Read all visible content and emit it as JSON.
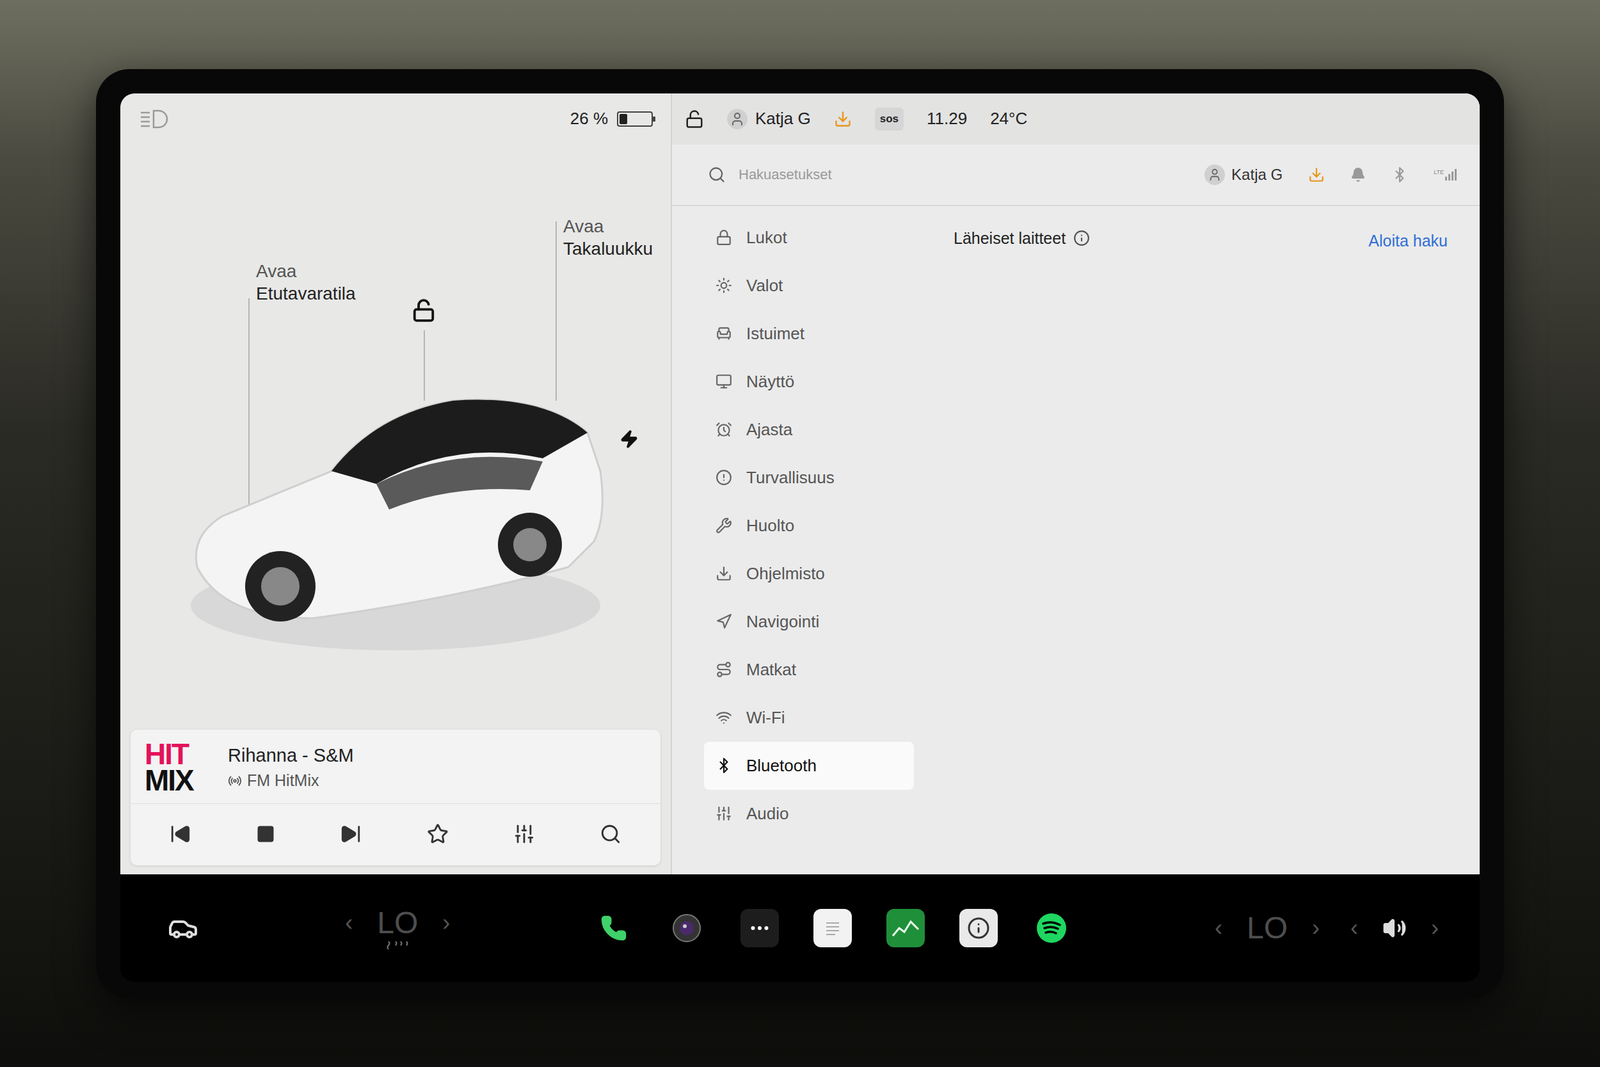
{
  "status_bar": {
    "battery_percent": "26 %",
    "battery_level": 0.26,
    "locked": false,
    "user": "Katja G",
    "sos": "sos",
    "time": "11.29",
    "temperature": "24°C"
  },
  "car": {
    "frunk": {
      "action": "Avaa",
      "target": "Etutavaratila"
    },
    "trunk": {
      "action": "Avaa",
      "target": "Takaluukku"
    },
    "locked": false,
    "charging": true
  },
  "media": {
    "logo_top": "HIT",
    "logo_bottom": "MIX",
    "title": "Rihanna - S&M",
    "source": "FM HitMix",
    "playing": true,
    "favorite": false
  },
  "settings": {
    "search_placeholder": "Hakuasetukset",
    "user": "Katja G",
    "network": "LTE",
    "items": [
      {
        "label": "Lukot",
        "selected": false
      },
      {
        "label": "Valot",
        "selected": false
      },
      {
        "label": "Istuimet",
        "selected": false
      },
      {
        "label": "Näyttö",
        "selected": false
      },
      {
        "label": "Ajasta",
        "selected": false
      },
      {
        "label": "Turvallisuus",
        "selected": false
      },
      {
        "label": "Huolto",
        "selected": false
      },
      {
        "label": "Ohjelmisto",
        "selected": false
      },
      {
        "label": "Navigointi",
        "selected": false
      },
      {
        "label": "Matkat",
        "selected": false
      },
      {
        "label": "Wi-Fi",
        "selected": false
      },
      {
        "label": "Bluetooth",
        "selected": true
      },
      {
        "label": "Audio",
        "selected": false
      }
    ]
  },
  "content": {
    "heading": "Läheiset laitteet",
    "action": "Aloita haku"
  },
  "bottom_bar": {
    "left_climate": {
      "prev": "‹",
      "value": "LO",
      "next": "›"
    },
    "right_climate": {
      "prev": "‹",
      "value": "LO",
      "next": "›"
    },
    "volume": {
      "prev": "‹",
      "next": "›"
    }
  }
}
